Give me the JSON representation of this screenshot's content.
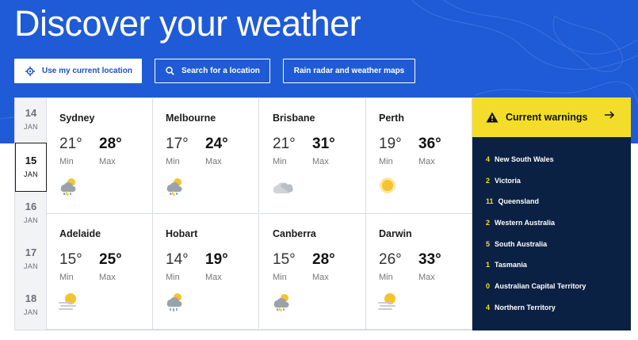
{
  "hero": {
    "title": "Discover your weather",
    "buttons": {
      "location": "Use my current location",
      "search": "Search for a location",
      "radar": "Rain radar and weather maps"
    }
  },
  "dates": [
    {
      "day": "14",
      "month": "JAN",
      "active": false
    },
    {
      "day": "15",
      "month": "JAN",
      "active": true
    },
    {
      "day": "16",
      "month": "JAN",
      "active": false
    },
    {
      "day": "17",
      "month": "JAN",
      "active": false
    },
    {
      "day": "18",
      "month": "JAN",
      "active": false
    }
  ],
  "labels": {
    "min": "Min",
    "max": "Max"
  },
  "cities": [
    {
      "name": "Sydney",
      "min": "21°",
      "max": "28°",
      "icon": "storm-icon"
    },
    {
      "name": "Melbourne",
      "min": "17°",
      "max": "24°",
      "icon": "storm-icon"
    },
    {
      "name": "Brisbane",
      "min": "21°",
      "max": "31°",
      "icon": "cloudy-icon"
    },
    {
      "name": "Perth",
      "min": "19°",
      "max": "36°",
      "icon": "sunny-icon"
    },
    {
      "name": "Adelaide",
      "min": "15°",
      "max": "25°",
      "icon": "hazy-sun-icon"
    },
    {
      "name": "Hobart",
      "min": "14°",
      "max": "19°",
      "icon": "showers-icon"
    },
    {
      "name": "Canberra",
      "min": "15°",
      "max": "28°",
      "icon": "storm-icon"
    },
    {
      "name": "Darwin",
      "min": "26°",
      "max": "33°",
      "icon": "hazy-sun-icon"
    }
  ],
  "warnings": {
    "title": "Current warnings",
    "items": [
      {
        "count": "4",
        "region": "New South Wales"
      },
      {
        "count": "2",
        "region": "Victoria"
      },
      {
        "count": "11",
        "region": "Queensland"
      },
      {
        "count": "2",
        "region": "Western Australia"
      },
      {
        "count": "5",
        "region": "South Australia"
      },
      {
        "count": "1",
        "region": "Tasmania"
      },
      {
        "count": "0",
        "region": "Australian Capital Territory"
      },
      {
        "count": "4",
        "region": "Northern Territory"
      }
    ]
  },
  "colors": {
    "hero": "#1f5bd6",
    "warning_yellow": "#f4dd2a",
    "warning_navy": "#0b2143",
    "accent": "#1f4fc4"
  }
}
